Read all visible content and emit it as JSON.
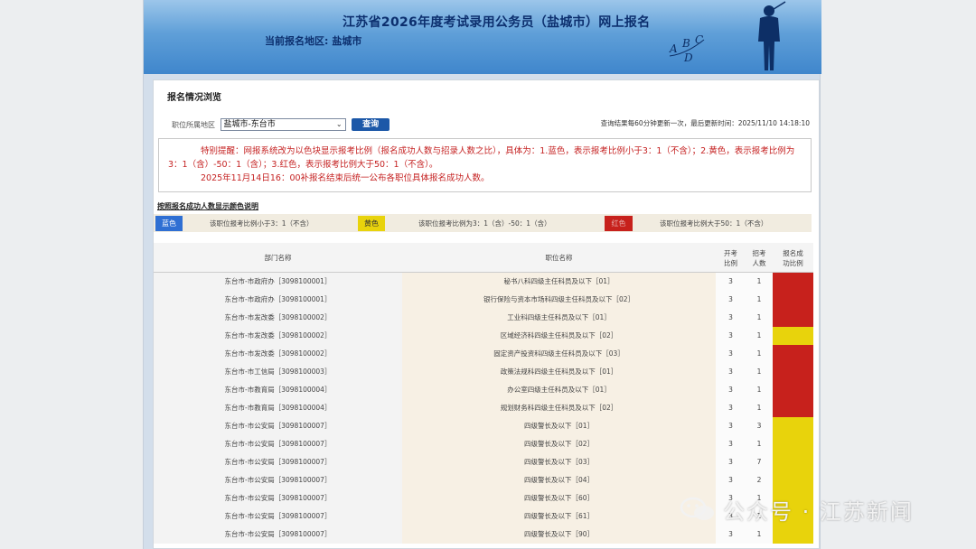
{
  "header": {
    "title": "江苏省2026年度考试录用公务员（盐城市）网上报名",
    "region_label": "当前报名地区:",
    "region_value": "盐城市",
    "logo_letters": "A B C D"
  },
  "panel": {
    "heading": "报名情况浏览",
    "filter_label": "职位所属地区",
    "filter_value": "盐城市-东台市",
    "query_button": "查询",
    "refresh_note": "查询结果每60分钟更新一次，最后更新时间：2025/11/10 14:18:10"
  },
  "notice": {
    "line1": "特别提醒：网报系统改为以色块显示报考比例（报名成功人数与招录人数之比），具体为：1.蓝色，表示报考比例小于3：1（不含）；2.黄色，表示报考比例为3：1（含）-50：1（含）；3.红色，表示报考比例大于50：1（不含）。",
    "line2": "2025年11月14日16：00补报名结束后统一公布各职位具体报名成功人数。"
  },
  "legend": {
    "title": "按照报名成功人数显示颜色说明",
    "items": [
      {
        "swatch_label": "蓝色",
        "color": "#2f6fd3",
        "description": "该职位报考比例小于3：1（不含）"
      },
      {
        "swatch_label": "黄色",
        "color": "#e8d30c",
        "description": "该职位报考比例为3：1（含）-50：1（含）"
      },
      {
        "swatch_label": "红色",
        "color": "#c7211c",
        "description": "该职位报考比例大于50：1（不含）"
      }
    ]
  },
  "table": {
    "headers": {
      "dept": "部门名称",
      "position": "职位名称",
      "ratio_line1": "开考",
      "ratio_line2": "比例",
      "recruit_line1": "招考",
      "recruit_line2": "人数",
      "status_line1": "报名成",
      "status_line2": "功比例"
    },
    "rows": [
      {
        "dept": "东台市-市政府办［3098100001］",
        "position": "秘书八科四级主任科员及以下［01］",
        "ratio": "3",
        "recruit": "1",
        "status": "red"
      },
      {
        "dept": "东台市-市政府办［3098100001］",
        "position": "银行保险与资本市场科四级主任科员及以下［02］",
        "ratio": "3",
        "recruit": "1",
        "status": "red"
      },
      {
        "dept": "东台市-市发改委［3098100002］",
        "position": "工业科四级主任科员及以下［01］",
        "ratio": "3",
        "recruit": "1",
        "status": "red"
      },
      {
        "dept": "东台市-市发改委［3098100002］",
        "position": "区域经济科四级主任科员及以下［02］",
        "ratio": "3",
        "recruit": "1",
        "status": "yellow"
      },
      {
        "dept": "东台市-市发改委［3098100002］",
        "position": "固定资产投资科四级主任科员及以下［03］",
        "ratio": "3",
        "recruit": "1",
        "status": "red"
      },
      {
        "dept": "东台市-市工信局［3098100003］",
        "position": "政策法规科四级主任科员及以下［01］",
        "ratio": "3",
        "recruit": "1",
        "status": "red"
      },
      {
        "dept": "东台市-市教育局［3098100004］",
        "position": "办公室四级主任科员及以下［01］",
        "ratio": "3",
        "recruit": "1",
        "status": "red"
      },
      {
        "dept": "东台市-市教育局［3098100004］",
        "position": "规划财务科四级主任科员及以下［02］",
        "ratio": "3",
        "recruit": "1",
        "status": "red"
      },
      {
        "dept": "东台市-市公安局［3098100007］",
        "position": "四级警长及以下［01］",
        "ratio": "3",
        "recruit": "3",
        "status": "yellow"
      },
      {
        "dept": "东台市-市公安局［3098100007］",
        "position": "四级警长及以下［02］",
        "ratio": "3",
        "recruit": "1",
        "status": "yellow"
      },
      {
        "dept": "东台市-市公安局［3098100007］",
        "position": "四级警长及以下［03］",
        "ratio": "3",
        "recruit": "7",
        "status": "yellow"
      },
      {
        "dept": "东台市-市公安局［3098100007］",
        "position": "四级警长及以下［04］",
        "ratio": "3",
        "recruit": "2",
        "status": "yellow"
      },
      {
        "dept": "东台市-市公安局［3098100007］",
        "position": "四级警长及以下［60］",
        "ratio": "3",
        "recruit": "1",
        "status": "yellow"
      },
      {
        "dept": "东台市-市公安局［3098100007］",
        "position": "四级警长及以下［61］",
        "ratio": "3",
        "recruit": "1",
        "status": "yellow"
      },
      {
        "dept": "东台市-市公安局［3098100007］",
        "position": "四级警长及以下［90］",
        "ratio": "3",
        "recruit": "1",
        "status": "yellow"
      }
    ]
  },
  "status_colors": {
    "red": "#c7211c",
    "yellow": "#e8d30c",
    "blue": "#2f6fd3"
  },
  "watermark": {
    "text": "公众号 · 江苏新闻"
  }
}
